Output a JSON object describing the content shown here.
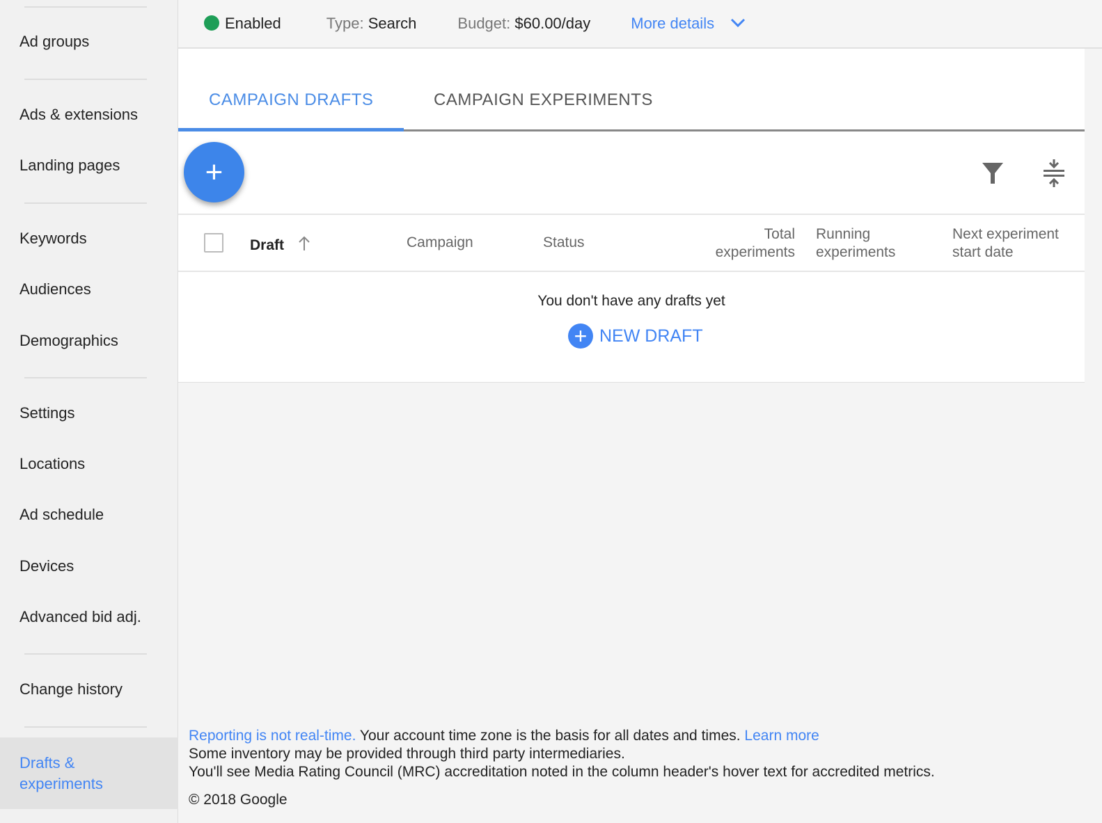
{
  "sidebar": {
    "items": [
      "Ad groups",
      "Ads & extensions",
      "Landing pages",
      "Keywords",
      "Audiences",
      "Demographics",
      "Settings",
      "Locations",
      "Ad schedule",
      "Devices",
      "Advanced bid adj.",
      "Change history"
    ],
    "active": "Drafts & experiments"
  },
  "topbar": {
    "status": "Enabled",
    "type_label": "Type:",
    "type_value": "Search",
    "budget_label": "Budget:",
    "budget_value": "$60.00/day",
    "more_details": "More details",
    "status_color": "#1e9e57"
  },
  "tabs": [
    {
      "label": "CAMPAIGN DRAFTS",
      "active": true
    },
    {
      "label": "CAMPAIGN EXPERIMENTS",
      "active": false
    }
  ],
  "table": {
    "columns": [
      "Draft",
      "Campaign",
      "Status",
      "Total experiments",
      "Running experiments",
      "Next experiment start date"
    ],
    "empty_text": "You don't have any drafts yet",
    "new_draft": "NEW DRAFT"
  },
  "footer": {
    "link1": "Reporting is not real-time.",
    "text1": " Your account time zone is the basis for all dates and times. ",
    "link2": "Learn more",
    "line2": "Some inventory may be provided through third party intermediaries.",
    "line3": "You'll see Media Rating Council (MRC) accreditation noted in the column header's hover text for accredited metrics.",
    "copyright": "© 2018 Google"
  },
  "accent": "#4285f4"
}
